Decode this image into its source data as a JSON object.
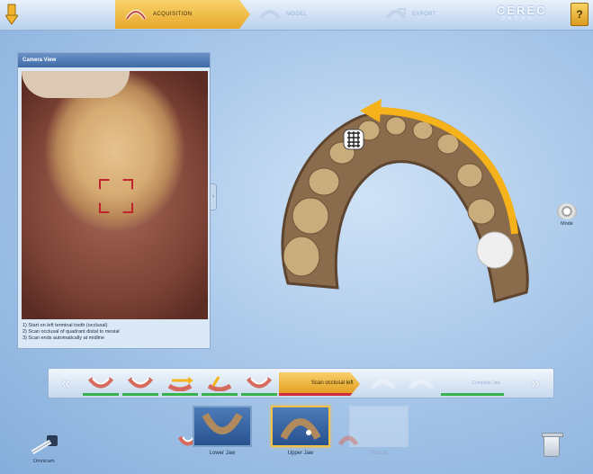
{
  "app": {
    "brand": "CEREC",
    "brand_sub": "ORTHO"
  },
  "workflow": {
    "steps": [
      {
        "label": "ACQUISITION",
        "state": "active"
      },
      {
        "label": "MODEL",
        "state": "disabled"
      },
      {
        "label": "EXPORT",
        "state": "disabled"
      }
    ]
  },
  "camera_panel": {
    "title": "Camera View",
    "instructions": [
      "1) Start on left terminal tooth (occlusal)",
      "2) Scan occlusal of quadrant distal to mesial",
      "3) Scan ends automatically at midline"
    ]
  },
  "mode": {
    "label": "Mode"
  },
  "scan_steps": {
    "active_label": "Scan occlusal left",
    "complete_label": "Complete Jaw"
  },
  "catalog": [
    {
      "label": "Lower Jaw",
      "state": "done"
    },
    {
      "label": "Upper Jaw",
      "state": "selected"
    },
    {
      "label": "Buccal",
      "state": "empty"
    }
  ],
  "device": {
    "label": "Omnicam"
  },
  "colors": {
    "accent": "#f0b33a",
    "progress_done": "#38b24a",
    "progress_current": "#d1293a",
    "arrow": "#f5b21a"
  }
}
